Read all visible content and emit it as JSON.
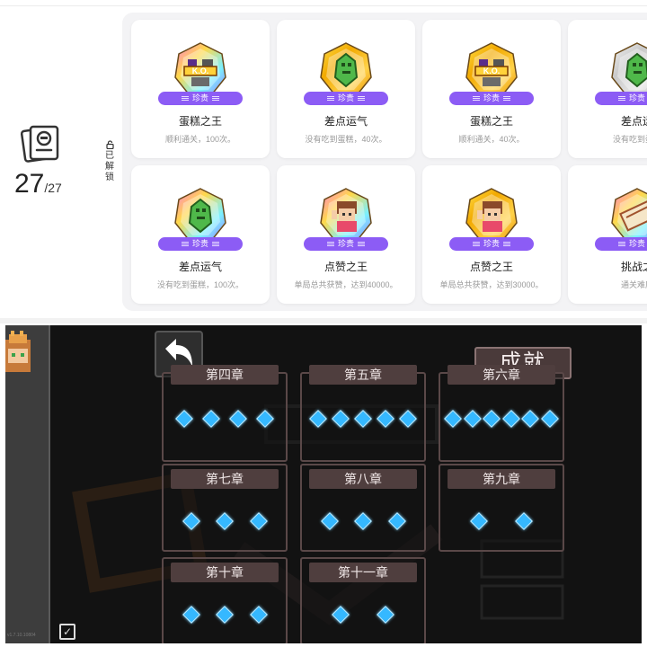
{
  "counter": {
    "value": "27",
    "total": "/27"
  },
  "unlock_label": [
    "已",
    "解",
    "锁"
  ],
  "cards": [
    {
      "title": "蛋糕之王",
      "desc": "顺利通关，100次。",
      "rarity": "珍贵",
      "badge": "ko-badge-icon",
      "frame": "rainbow"
    },
    {
      "title": "差点运气",
      "desc": "没有吃到蛋糕，40次。",
      "rarity": "珍贵",
      "badge": "green-gem-badge-icon",
      "frame": "gold"
    },
    {
      "title": "蛋糕之王",
      "desc": "顺利通关，40次。",
      "rarity": "珍贵",
      "badge": "ko-badge-icon",
      "frame": "gold"
    },
    {
      "title": "差点运",
      "desc": "没有吃到蛋糕",
      "rarity": "珍贵",
      "badge": "green-gem-badge-icon",
      "frame": "silver"
    },
    {
      "title": "差点运气",
      "desc": "没有吃到蛋糕，100次。",
      "rarity": "珍贵",
      "badge": "green-gem-badge-icon",
      "frame": "rainbow"
    },
    {
      "title": "点赞之王",
      "desc": "单局总共获赞，达到40000。",
      "rarity": "珍贵",
      "badge": "thumbs-up-girl-badge-icon",
      "frame": "rainbow"
    },
    {
      "title": "点赞之王",
      "desc": "单局总共获赞，达到30000。",
      "rarity": "珍贵",
      "badge": "thumbs-up-girl-badge-icon",
      "frame": "gold"
    },
    {
      "title": "挑战之",
      "desc": "通关难度",
      "rarity": "珍贵",
      "badge": "scroll-badge-icon",
      "frame": "rainbow"
    }
  ],
  "game": {
    "title": "成就",
    "chapters": [
      {
        "label": "第四章",
        "gems": 4
      },
      {
        "label": "第五章",
        "gems": 5
      },
      {
        "label": "第六章",
        "gems": 6
      },
      {
        "label": "第七章",
        "gems": 3
      },
      {
        "label": "第八章",
        "gems": 3
      },
      {
        "label": "第九章",
        "gems": 2
      },
      {
        "label": "第十章",
        "gems": 3
      },
      {
        "label": "第十一章",
        "gems": 2
      }
    ],
    "version": "v1.7.10.10804"
  },
  "colors": {
    "rarity_purple": "#8c5cf5",
    "gem_blue": "#35b8ff",
    "game_bg": "#121212",
    "chapter_head": "#4f3e3e"
  }
}
